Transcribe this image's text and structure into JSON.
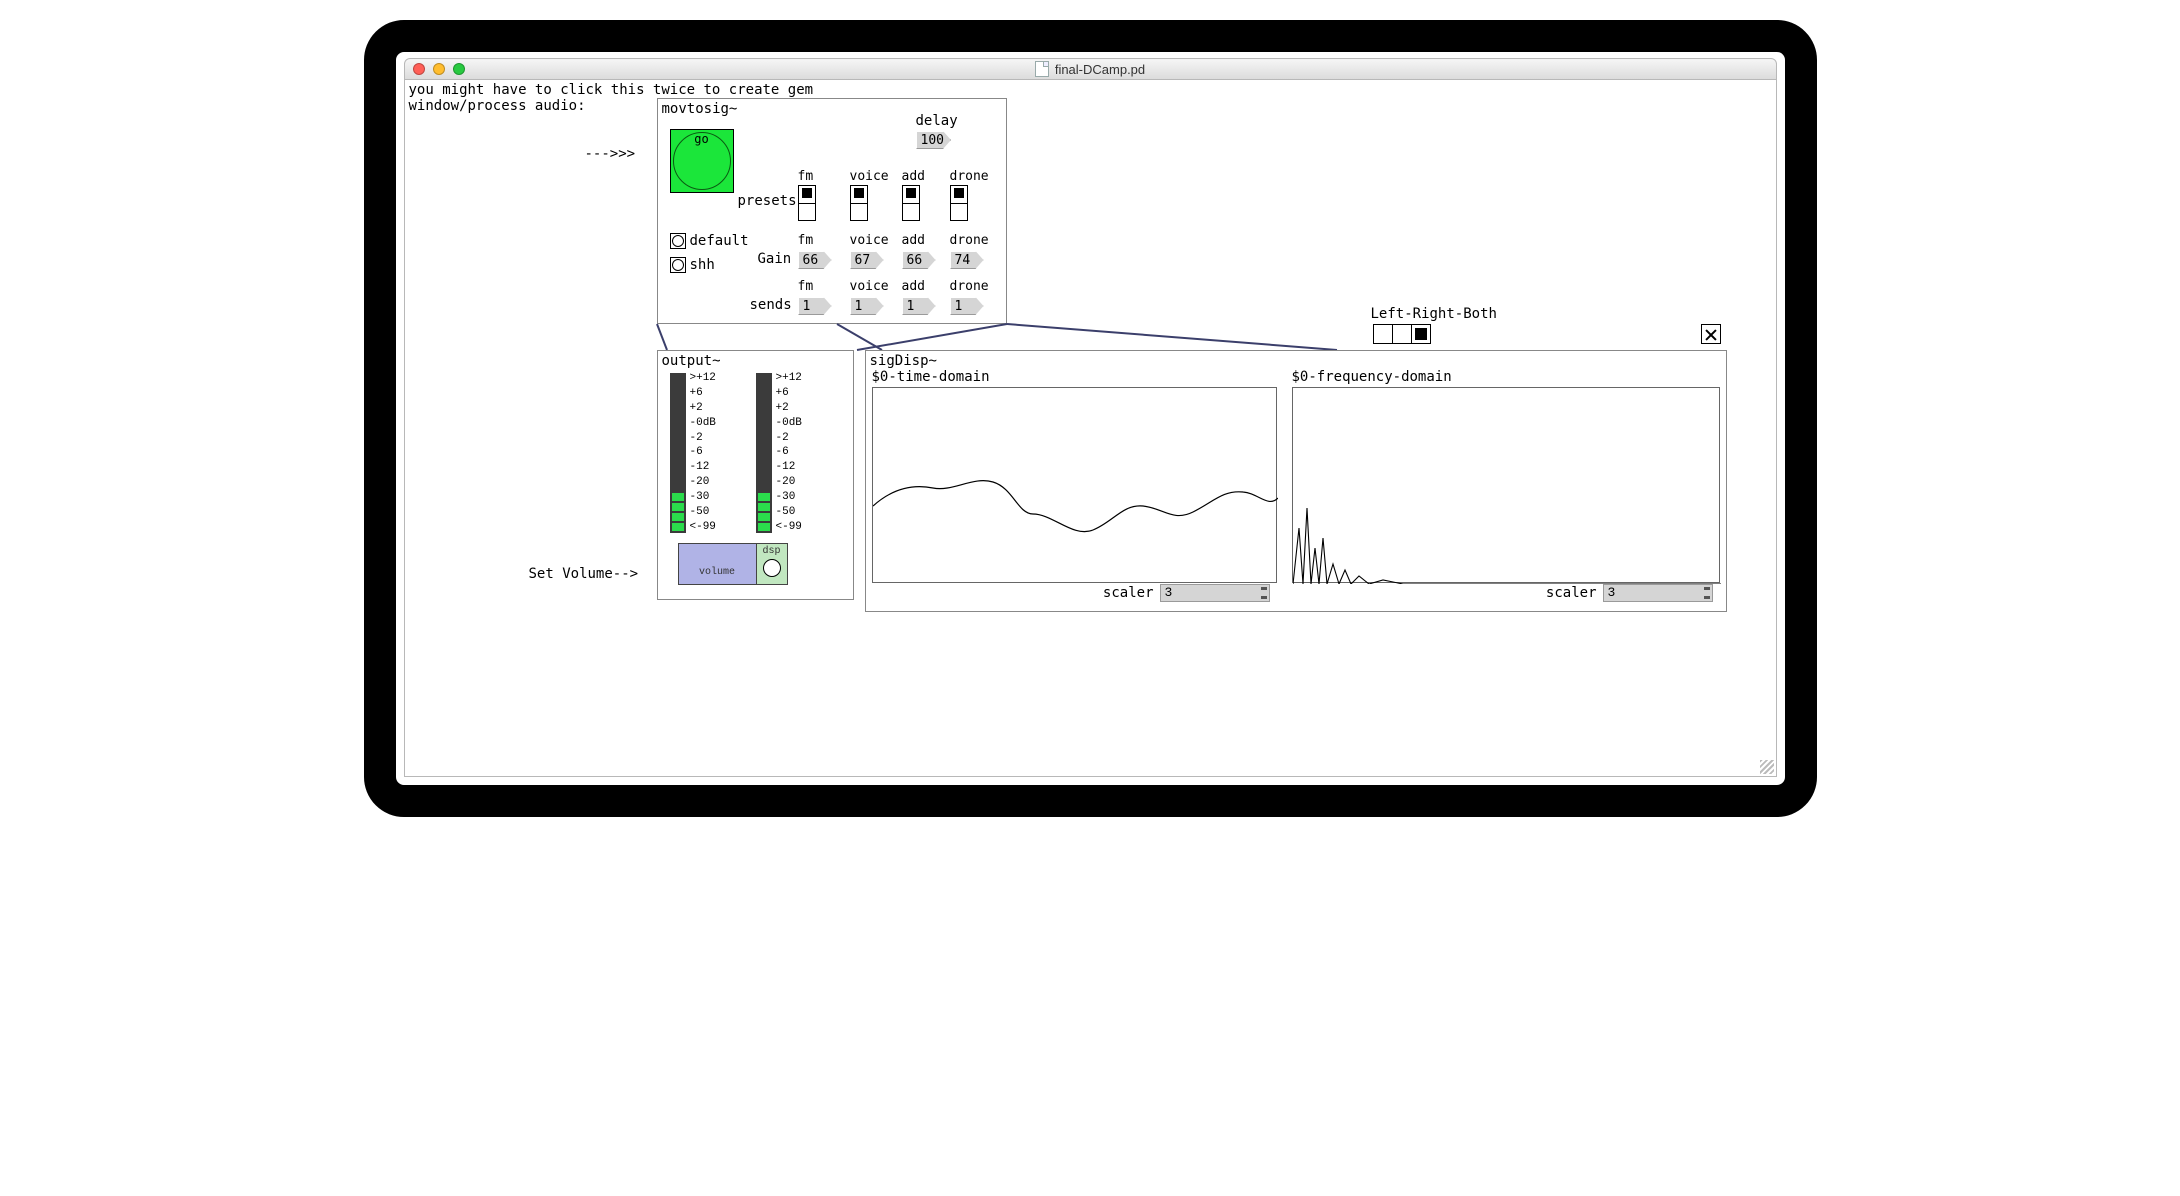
{
  "window": {
    "title": "final-DCamp.pd"
  },
  "hints": {
    "line1": "you might have to click this twice to create gem",
    "line2": "window/process audio:",
    "arrow": "--->>>",
    "set_volume": "Set Volume-->"
  },
  "movtosig": {
    "title": "movtosig~",
    "go_label": "go",
    "presets_label": "presets",
    "default_label": "default",
    "shh_label": "shh",
    "delay": {
      "label": "delay",
      "value": "100"
    },
    "channels": [
      "fm",
      "voice",
      "add",
      "drone"
    ],
    "gain": {
      "label": "Gain",
      "values": [
        "66",
        "67",
        "66",
        "74"
      ]
    },
    "sends": {
      "label": "sends",
      "values": [
        "1",
        "1",
        "1",
        "1"
      ]
    }
  },
  "output": {
    "title": "output~",
    "scale": [
      ">+12",
      "+6",
      "+2",
      "-0dB",
      "-2",
      "-6",
      "-12",
      "-20",
      "-30",
      "-50",
      "<-99"
    ],
    "volume_label": "volume",
    "dsp_label": "dsp"
  },
  "sigDisp": {
    "title": "sigDisp~",
    "time_label": "$0-time-domain",
    "freq_label": "$0-frequency-domain",
    "scaler_label": "scaler",
    "lrb_label": "Left-Right-Both",
    "lrb_selected_index": 2,
    "time_scaler": "3",
    "freq_scaler": "3"
  }
}
